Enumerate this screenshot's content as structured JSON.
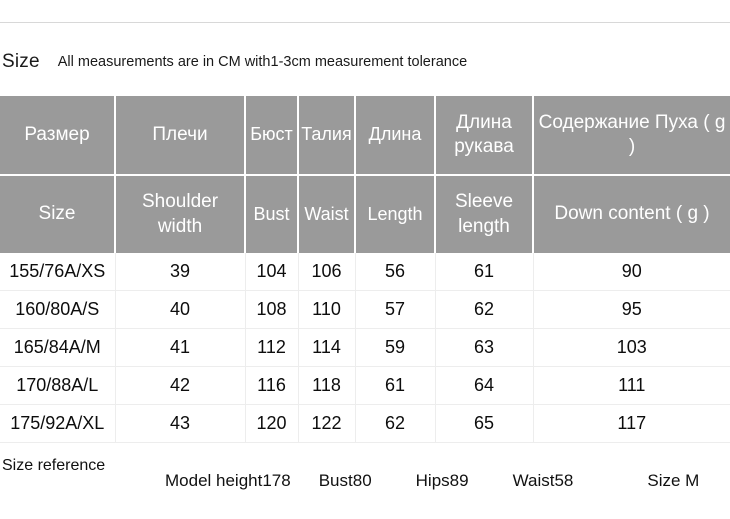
{
  "caption": {
    "title": "Size",
    "note": "All measurements are in CM with1-3cm measurement tolerance"
  },
  "table": {
    "header_ru": [
      "Размер",
      "Плечи",
      "Бюст",
      "Талия",
      "Длина",
      "Длина рукава",
      "Содержание Пуха ( g )"
    ],
    "header_en": [
      "Size",
      "Shoulder width",
      "Bust",
      "Waist",
      "Length",
      "Sleeve length",
      "Down content ( g )"
    ],
    "rows": [
      [
        "155/76A/XS",
        "39",
        "104",
        "106",
        "56",
        "61",
        "90"
      ],
      [
        "160/80A/S",
        "40",
        "108",
        "110",
        "57",
        "62",
        "95"
      ],
      [
        "165/84A/M",
        "41",
        "112",
        "114",
        "59",
        "63",
        "103"
      ],
      [
        "170/88A/L",
        "42",
        "116",
        "118",
        "61",
        "64",
        "111"
      ],
      [
        "175/92A/XL",
        "43",
        "120",
        "122",
        "62",
        "65",
        "117"
      ]
    ]
  },
  "reference": {
    "label": "Size reference",
    "items": [
      "Model height178",
      "Bust80",
      "Hips89",
      "Waist58",
      "Size M"
    ]
  },
  "colors": {
    "header_background": "#9a9a9a",
    "header_text": "#ffffff",
    "body_text": "#0d0d0d",
    "grid_line": "#ededed",
    "top_rule": "#d8d8d8"
  }
}
